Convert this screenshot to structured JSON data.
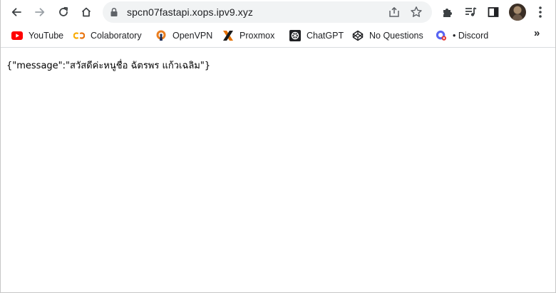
{
  "browser": {
    "url": "spcn07fastapi.xops.ipv9.xyz",
    "nav": {
      "back_icon": "arrow-left-icon",
      "forward_icon": "arrow-right-icon",
      "reload_icon": "reload-icon",
      "home_icon": "home-icon"
    },
    "toolbar_icons": [
      "share-icon",
      "star-icon",
      "extensions-icon",
      "media-queue-icon",
      "side-panel-icon",
      "avatar",
      "menu-icon"
    ]
  },
  "bookmarks": [
    {
      "label": "YouTube",
      "icon": "youtube-icon",
      "color": "#ff0000"
    },
    {
      "label": "Colaboratory",
      "icon": "colab-icon",
      "color": "#f9ab00"
    },
    {
      "label": "OpenVPN",
      "icon": "openvpn-icon",
      "color": "#ea7e20"
    },
    {
      "label": "Proxmox",
      "icon": "proxmox-icon",
      "color": "#e57000"
    },
    {
      "label": "ChatGPT",
      "icon": "chatgpt-icon",
      "color": "#202124"
    },
    {
      "label": "No Questions",
      "icon": "codepen-icon",
      "color": "#202124"
    },
    {
      "label": "• Discord",
      "icon": "discord-icon",
      "color": "#5865f2"
    }
  ],
  "bookmarks_overflow": "»",
  "page": {
    "body_text": "{\"message\":\"สวัสดีค่ะหนูชื่อ ฉัตรพร แก้วเฉลิม\"}"
  }
}
